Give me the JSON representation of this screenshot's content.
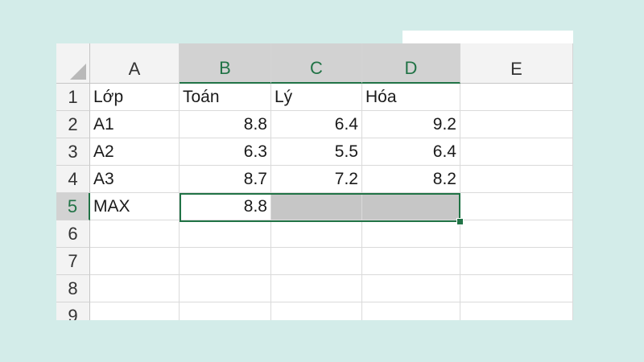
{
  "sheet": {
    "columns": [
      "A",
      "B",
      "C",
      "D",
      "E"
    ],
    "rows": [
      "1",
      "2",
      "3",
      "4",
      "5",
      "6",
      "7",
      "8",
      "9"
    ],
    "cells": {
      "A1": "Lớp",
      "B1": "Toán",
      "C1": "Lý",
      "D1": "Hóa",
      "A2": "A1",
      "B2": "8.8",
      "C2": "6.4",
      "D2": "9.2",
      "A3": "A2",
      "B3": "6.3",
      "C3": "5.5",
      "D3": "6.4",
      "A4": "A3",
      "B4": "8.7",
      "C4": "7.2",
      "D4": "8.2",
      "A5": "MAX",
      "B5": "8.8"
    },
    "selected_range": "B5:D5",
    "active_cell": "B5",
    "selected_columns": [
      "B",
      "C",
      "D"
    ],
    "selected_row": "5"
  },
  "colors": {
    "background": "#d3ece9",
    "accent": "#217346",
    "selection_fill": "#c6c6c6"
  }
}
